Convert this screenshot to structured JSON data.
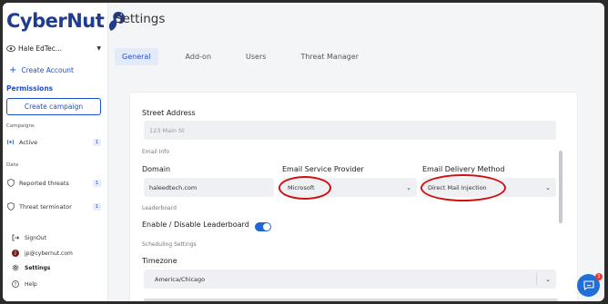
{
  "brand": {
    "name": "CyberNut",
    "accent": "#1f4fd1",
    "logo_icon": "squirrel-logo-icon"
  },
  "sidebar": {
    "org_name": "Hale EdTec...",
    "create_account": "Create Account",
    "permissions_label": "Permissions",
    "create_campaign": "Create campaign",
    "campaigns_label": "Campaigns",
    "campaign_items": [
      {
        "label": "Active",
        "count": "1",
        "icon": "broadcast-icon"
      }
    ],
    "data_label": "Data",
    "data_items": [
      {
        "label": "Reported threats",
        "count": "1",
        "icon": "shield-icon"
      },
      {
        "label": "Threat terminator",
        "count": "1",
        "icon": "shield-icon"
      }
    ],
    "bottom": {
      "signout": "SignOut",
      "user_email": "jp@cybernut.com",
      "avatar_initial": "J",
      "settings": "Settings",
      "help": "Help"
    }
  },
  "page": {
    "title": "Settings",
    "tabs": [
      "General",
      "Add-on",
      "Users",
      "Threat Manager"
    ],
    "active_tab": "General"
  },
  "form": {
    "street_address_label": "Street Address",
    "street_address_placeholder": "123 Main St",
    "email_info_label": "Email Info",
    "domain_label": "Domain",
    "domain_value": "haleedtech.com",
    "esp_label": "Email Service Provider",
    "esp_value": "Microsoft",
    "delivery_label": "Email Delivery Method",
    "delivery_value": "Direct Mail Injection",
    "leaderboard_section": "Leaderboard",
    "leaderboard_toggle_label": "Enable / Disable Leaderboard",
    "leaderboard_enabled": true,
    "scheduling_section": "Scheduling Settings",
    "timezone_label": "Timezone",
    "timezone_value": "America/Chicago"
  },
  "chat": {
    "badge": "1"
  }
}
